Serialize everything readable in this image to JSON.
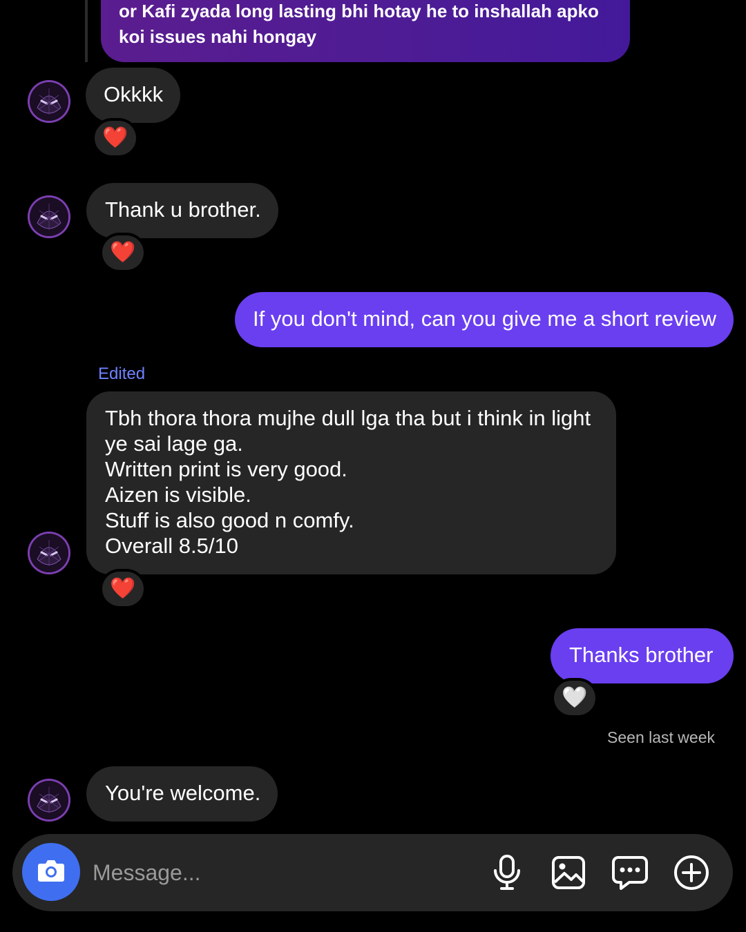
{
  "thread": {
    "quoted_message": "or Kafi zyada long lasting bhi hotay he to inshallah apko\nkoi issues nahi hongay"
  },
  "messages": [
    {
      "side": "in",
      "text": "Okkkk",
      "reaction": "❤️"
    },
    {
      "side": "in",
      "text": "Thank u brother.",
      "reaction": "❤️"
    },
    {
      "side": "out",
      "text": "If you don't mind, can you give me a short review"
    },
    {
      "side": "in",
      "edited_label": "Edited",
      "lines": [
        "Tbh thora thora mujhe dull lga tha but i think in light",
        "ye sai lage ga.",
        "Written print is very good.",
        "Aizen is visible.",
        "Stuff is also good n comfy.",
        "Overall 8.5/10"
      ],
      "reaction": "❤️"
    },
    {
      "side": "out",
      "text": "Thanks brother",
      "reaction": "🤍"
    },
    {
      "side": "in",
      "text": "You're welcome."
    }
  ],
  "seen_status": "Seen last week",
  "composer": {
    "placeholder": "Message...",
    "icons": [
      "camera-icon",
      "microphone-icon",
      "gallery-icon",
      "sticker-chat-icon",
      "add-circle-icon"
    ]
  },
  "colors": {
    "outgoing_bubble": "#6a3ff0",
    "incoming_bubble": "#262626",
    "camera_button": "#3f6ff0",
    "edited_label": "#6f82ff"
  }
}
